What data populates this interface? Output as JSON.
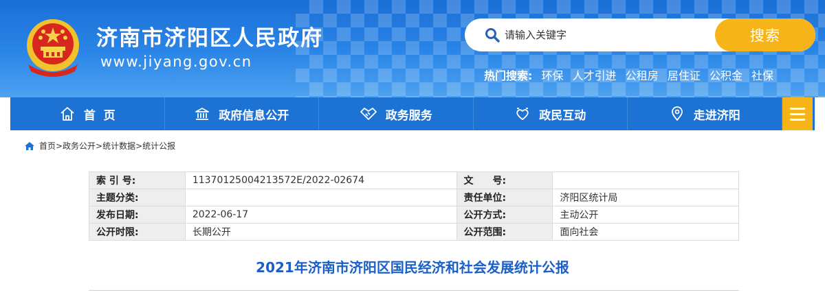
{
  "header": {
    "site_title": "济南市济阳区人民政府",
    "site_url": "www.jiyang.gov.cn",
    "search": {
      "placeholder": "请输入关键字",
      "button": "搜索"
    },
    "hot": {
      "label": "热门搜索:",
      "items": [
        "环保",
        "人才引进",
        "公租房",
        "居住证",
        "公积金",
        "社保"
      ]
    }
  },
  "nav": {
    "items": [
      {
        "label": "首  页",
        "icon": "home-icon"
      },
      {
        "label": "政府信息公开",
        "icon": "government-building-icon"
      },
      {
        "label": "政务服务",
        "icon": "handshake-icon"
      },
      {
        "label": "政民互动",
        "icon": "interaction-icon"
      },
      {
        "label": "走进济阳",
        "icon": "location-icon"
      }
    ],
    "menu_icon": "hamburger-menu-icon"
  },
  "breadcrumb": "首页>政务公开>统计数据>统计公报",
  "meta": {
    "rows": [
      {
        "k1": "索 引 号:",
        "v1": "11370125004213572E/2022-02674",
        "k2": "文　　号:",
        "v2": ""
      },
      {
        "k1": "主题分类:",
        "v1": "",
        "k2": "责任单位:",
        "v2": "济阳区统计局"
      },
      {
        "k1": "发布日期:",
        "v1": "2022-06-17",
        "k2": "公开方式:",
        "v2": "主动公开"
      },
      {
        "k1": "公开时限:",
        "v1": "长期公开",
        "k2": "公开范围:",
        "v2": "面向社会"
      }
    ]
  },
  "document": {
    "title": "2021年济南市济阳区国民经济和社会发展统计公报"
  },
  "colors": {
    "brand_blue": "#1c73d4",
    "accent_yellow": "#f6b418",
    "title_blue": "#1a5ec8"
  }
}
